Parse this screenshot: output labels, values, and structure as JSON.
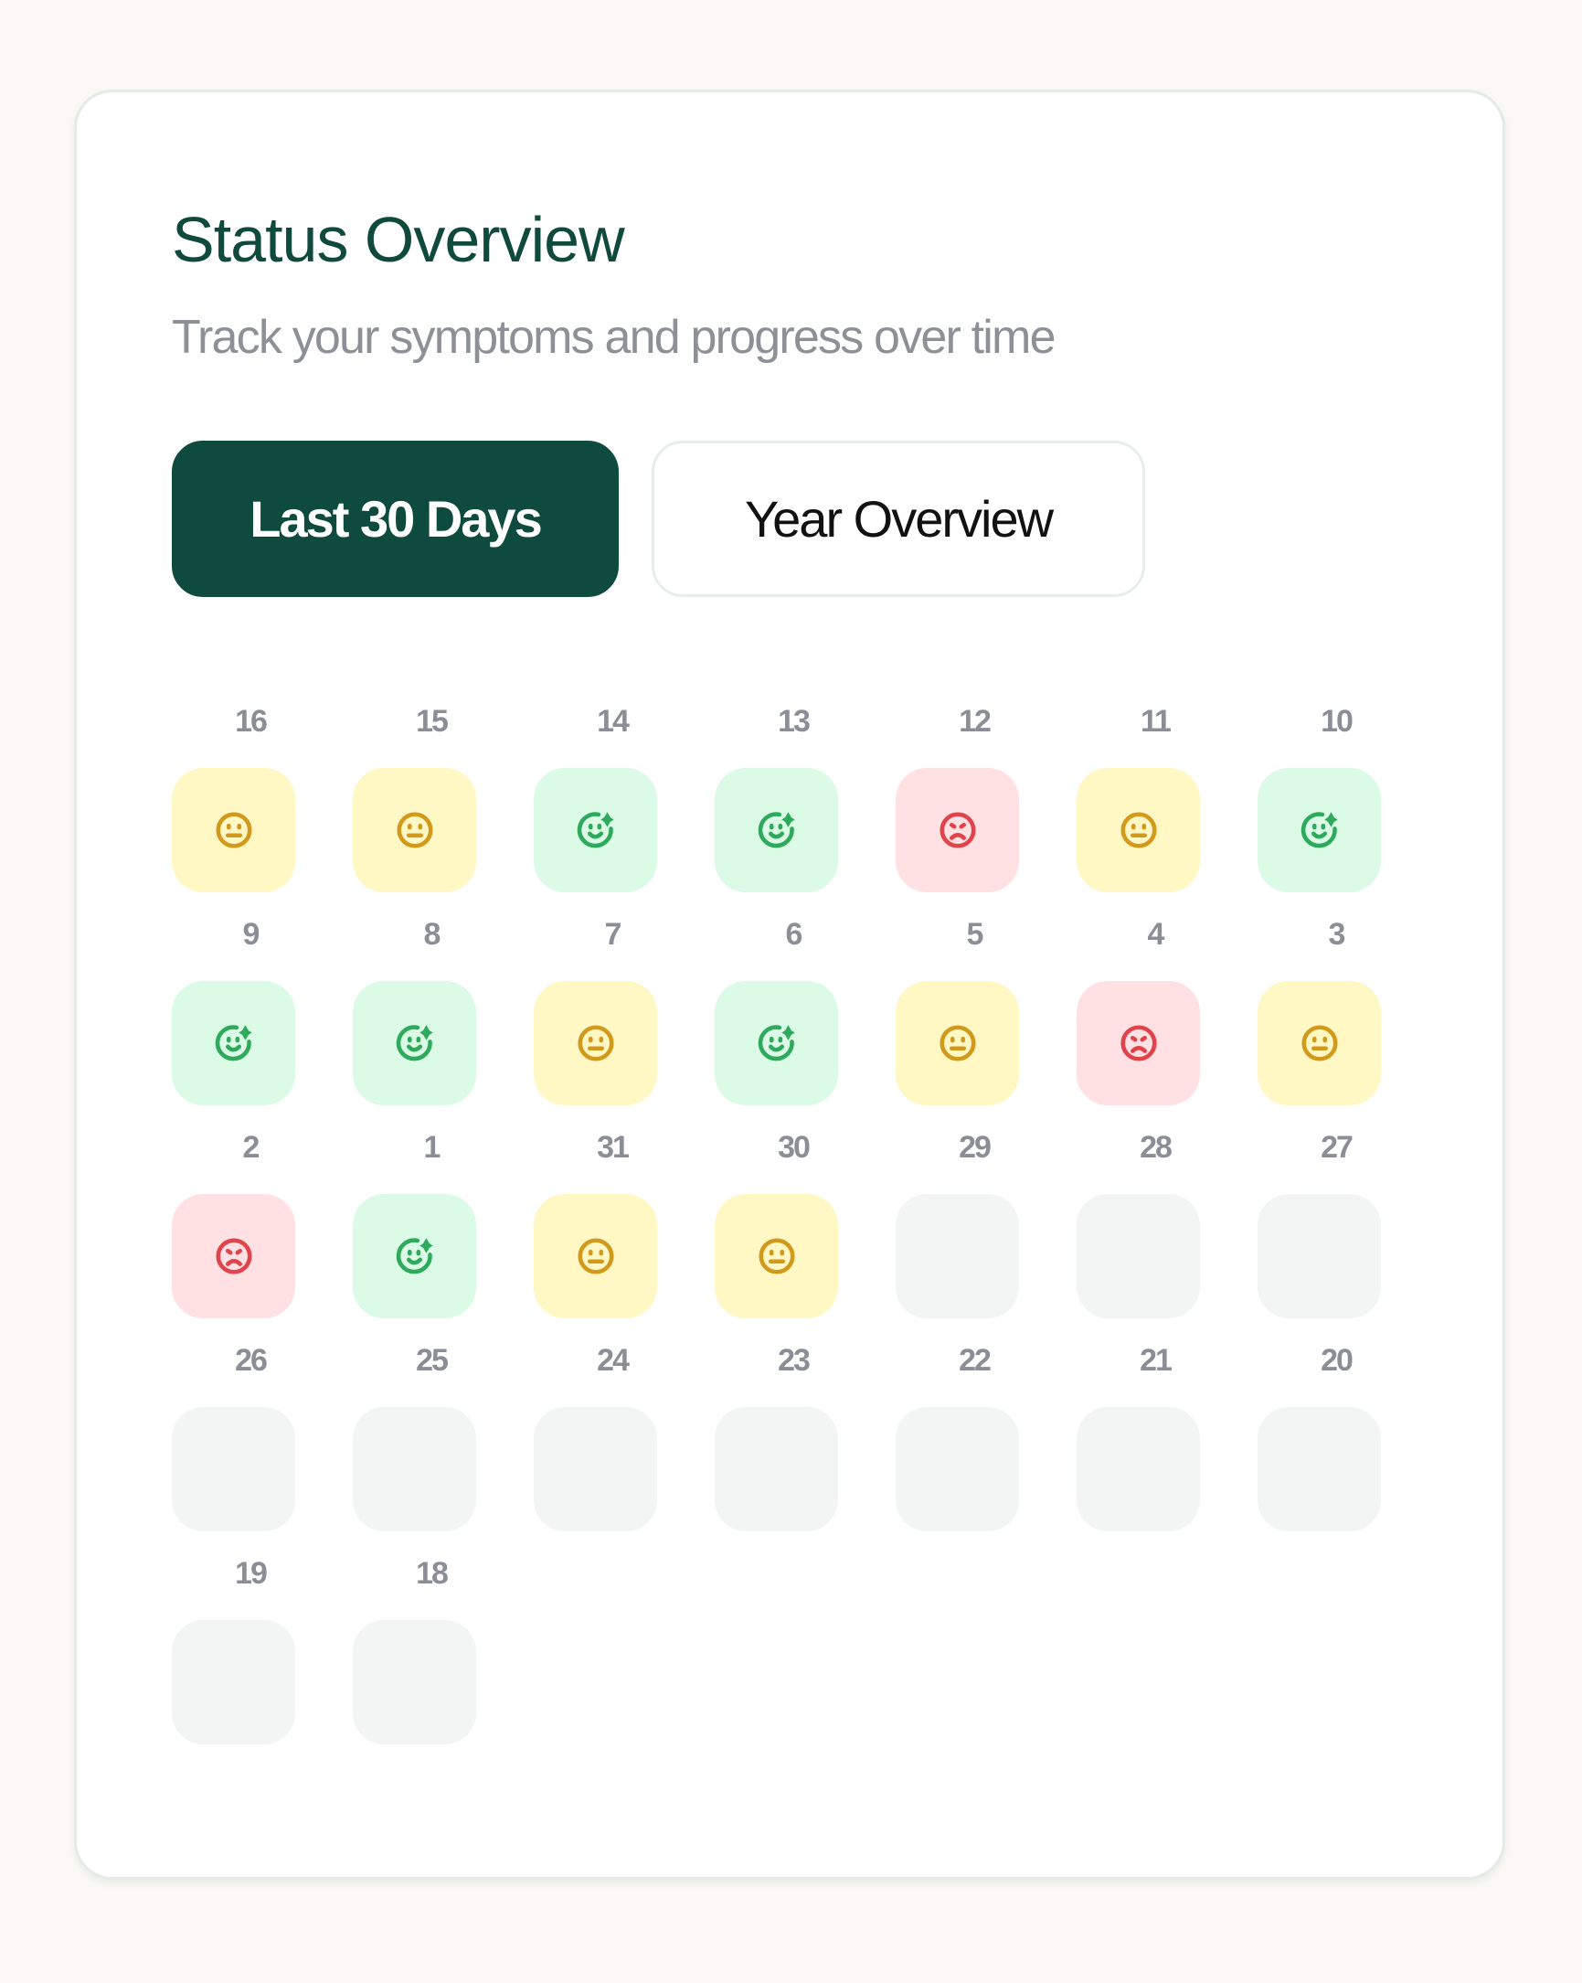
{
  "card": {
    "title": "Status Overview",
    "subtitle": "Track your symptoms and progress over time"
  },
  "tabs": [
    {
      "label": "Last 30 Days",
      "active": true
    },
    {
      "label": "Year Overview",
      "active": false
    }
  ],
  "colors": {
    "brand": "#0e4a3e",
    "good_bg": "#dcfbe6",
    "good_icon": "#2faa5c",
    "neutral_bg": "#fff8c4",
    "neutral_icon": "#d19a1c",
    "bad_bg": "#ffe1e3",
    "bad_icon": "#e0434b",
    "empty_bg": "#f3f5f4"
  },
  "days": [
    {
      "day": "16",
      "status": "neutral",
      "icon": "neutral-face-icon"
    },
    {
      "day": "15",
      "status": "neutral",
      "icon": "neutral-face-icon"
    },
    {
      "day": "14",
      "status": "good",
      "icon": "happy-face-sparkle-icon"
    },
    {
      "day": "13",
      "status": "good",
      "icon": "happy-face-sparkle-icon"
    },
    {
      "day": "12",
      "status": "bad",
      "icon": "sad-face-icon"
    },
    {
      "day": "11",
      "status": "neutral",
      "icon": "neutral-face-icon"
    },
    {
      "day": "10",
      "status": "good",
      "icon": "happy-face-sparkle-icon"
    },
    {
      "day": "9",
      "status": "good",
      "icon": "happy-face-sparkle-icon"
    },
    {
      "day": "8",
      "status": "good",
      "icon": "happy-face-sparkle-icon"
    },
    {
      "day": "7",
      "status": "neutral",
      "icon": "neutral-face-icon"
    },
    {
      "day": "6",
      "status": "good",
      "icon": "happy-face-sparkle-icon"
    },
    {
      "day": "5",
      "status": "neutral",
      "icon": "neutral-face-icon"
    },
    {
      "day": "4",
      "status": "bad",
      "icon": "sad-face-icon"
    },
    {
      "day": "3",
      "status": "neutral",
      "icon": "neutral-face-icon"
    },
    {
      "day": "2",
      "status": "bad",
      "icon": "sad-face-icon"
    },
    {
      "day": "1",
      "status": "good",
      "icon": "happy-face-sparkle-icon"
    },
    {
      "day": "31",
      "status": "neutral",
      "icon": "neutral-face-icon"
    },
    {
      "day": "30",
      "status": "neutral",
      "icon": "neutral-face-icon"
    },
    {
      "day": "29",
      "status": "empty",
      "icon": null
    },
    {
      "day": "28",
      "status": "empty",
      "icon": null
    },
    {
      "day": "27",
      "status": "empty",
      "icon": null
    },
    {
      "day": "26",
      "status": "empty",
      "icon": null
    },
    {
      "day": "25",
      "status": "empty",
      "icon": null
    },
    {
      "day": "24",
      "status": "empty",
      "icon": null
    },
    {
      "day": "23",
      "status": "empty",
      "icon": null
    },
    {
      "day": "22",
      "status": "empty",
      "icon": null
    },
    {
      "day": "21",
      "status": "empty",
      "icon": null
    },
    {
      "day": "20",
      "status": "empty",
      "icon": null
    },
    {
      "day": "19",
      "status": "empty",
      "icon": null
    },
    {
      "day": "18",
      "status": "empty",
      "icon": null
    }
  ]
}
